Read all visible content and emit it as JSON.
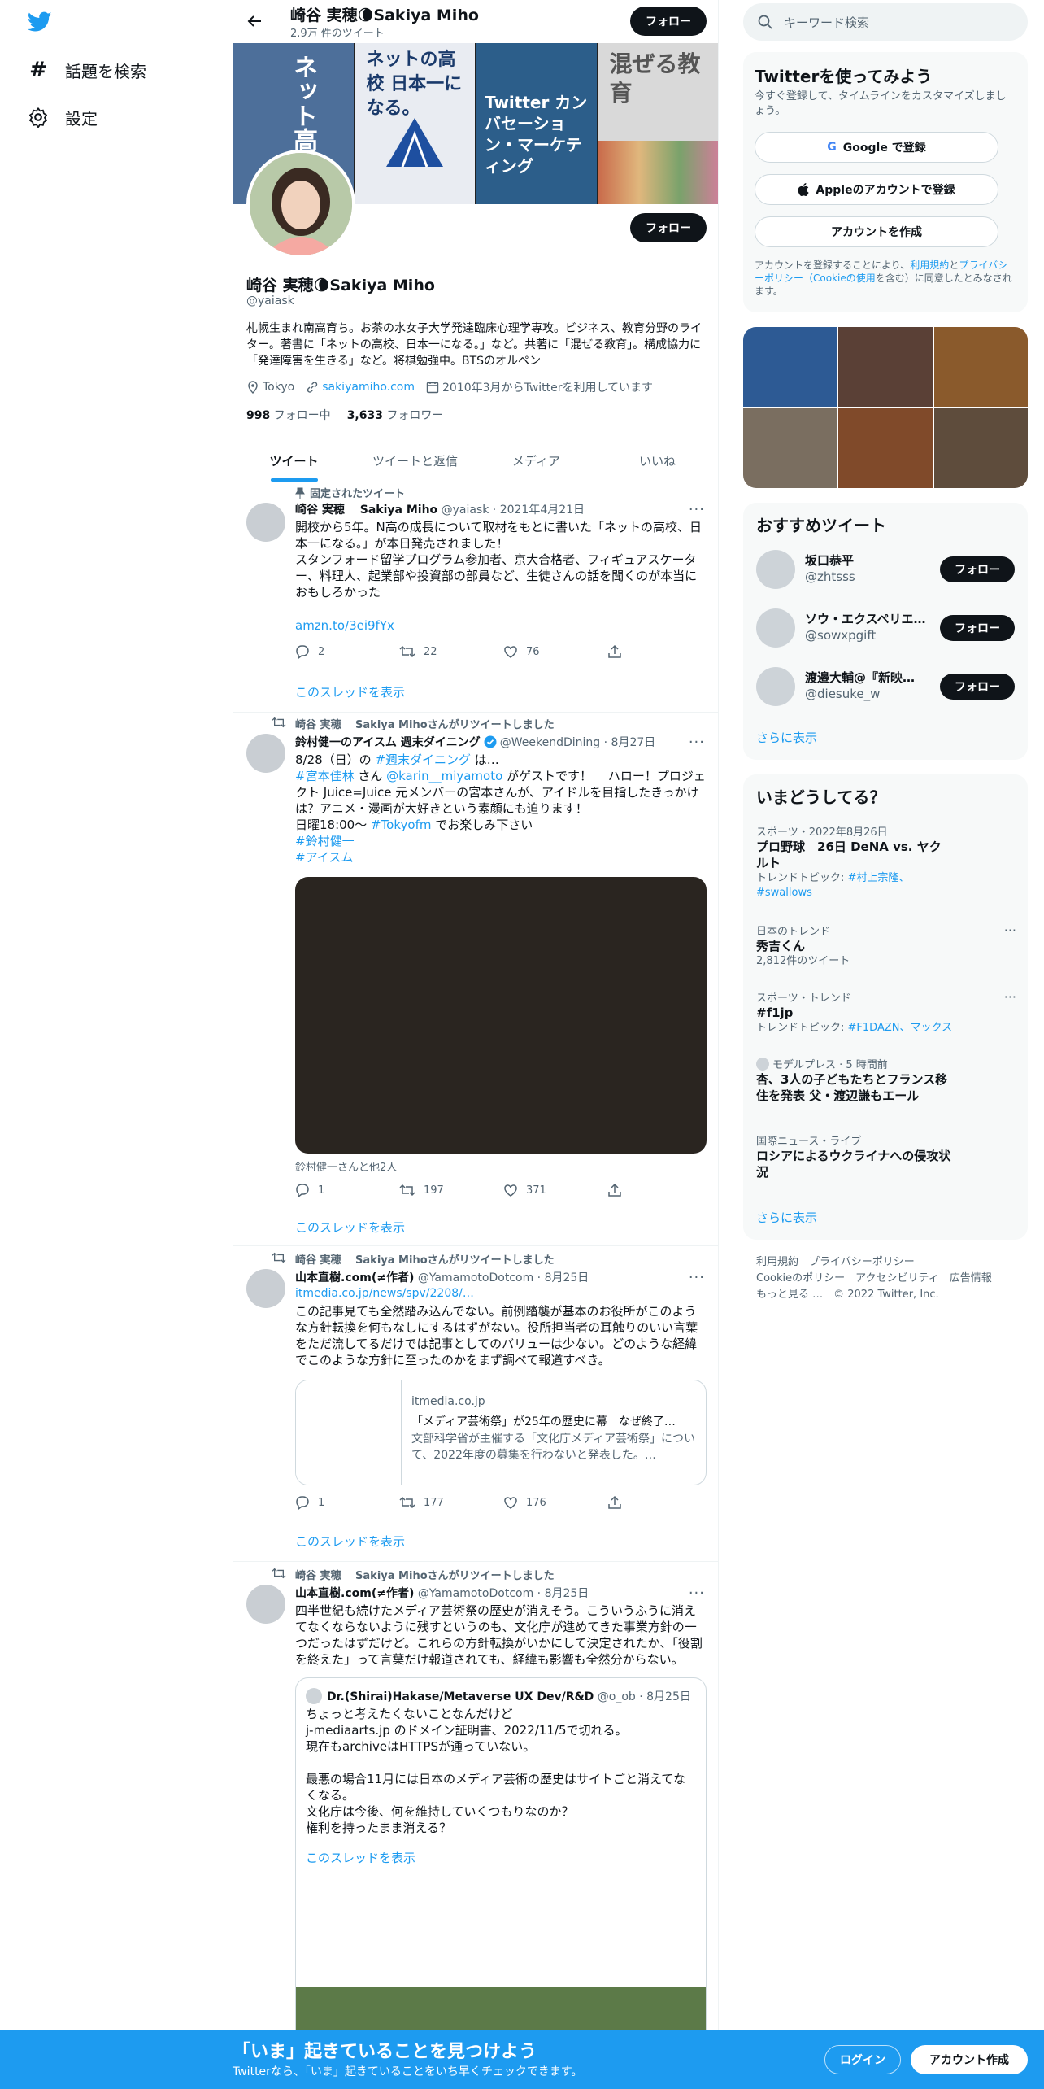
{
  "leftnav": {
    "items": [
      {
        "label": "話題を検索",
        "icon": "hashtag-icon"
      },
      {
        "label": "設定",
        "icon": "gear-icon"
      }
    ]
  },
  "profile_header": {
    "name": "崎谷 実穂🌘Sakiya Miho",
    "tweet_count": "2.9万 件のツイート",
    "follow_label": "フォロー"
  },
  "banner_books": [
    {
      "title": "ネット高校"
    },
    {
      "title": "ネットの高校 日本一になる。"
    },
    {
      "title": "Twitter カンバセーション・マーケティング"
    },
    {
      "title": "混ぜる教育"
    }
  ],
  "profile": {
    "name": "崎谷 実穂🌘Sakiya Miho",
    "handle": "@yaiask",
    "bio": "札幌生まれ南高育ち。お茶の水女子大学発達臨床心理学専攻。ビジネス、教育分野のライター。著書に「ネットの高校、日本一になる。」など。共著に「混ぜる教育」。構成協力に「発達障害を生きる」など。将棋勉強中。BTSのオルペン",
    "location": "Tokyo",
    "website": "sakiyamiho.com",
    "joined": "2010年3月からTwitterを利用しています",
    "following_count": "998",
    "following_label": "フォロー中",
    "followers_count": "3,633",
    "followers_label": "フォロワー"
  },
  "tabs": [
    {
      "label": "ツイート",
      "active": true
    },
    {
      "label": "ツイートと返信",
      "active": false
    },
    {
      "label": "メディア",
      "active": false
    },
    {
      "label": "いいね",
      "active": false
    }
  ],
  "tweets": [
    {
      "context": "固定されたツイート",
      "author": "崎谷 実穂　 Sakiya Miho",
      "handle_date": "@yaiask · 2021年4月21日",
      "text": "開校から5年。N高の成長について取材をもとに書いた「ネットの高校、日本一になる。」が本日発売されました！\nスタンフォード留学プログラム参加者、京大合格者、フィギュアスケーター、料理人、起業部や投資部の部員など、生徒さんの話を聞くのが本当におもしろかった",
      "link": "amzn.to/3ei9fYx",
      "replies": "2",
      "retweets": "22",
      "likes": "76",
      "show_thread": "このスレッドを表示"
    },
    {
      "context": "崎谷 実穂　 Sakiya Mihoさんがリツイートしました",
      "author": "鈴村健一のアイスム 週末ダイニング",
      "handle_date": "@WeekendDining · 8月27日",
      "line1_pre": "8/28（日）の ",
      "line1_tag": "#週末ダイニング",
      "line1_post": " は…",
      "line2_tag": "#宮本佳林",
      "line2_mid": " さん ",
      "line2_mention": "@karin__miyamoto",
      "line2_post": " がゲストです！　 ハロー！プロジェクト Juice=Juice 元メンバーの宮本さんが、アイドルを目指したきっかけは？アニメ・漫画が大好きという素顔にも迫ります！",
      "line3_pre": "日曜18:00〜 ",
      "line3_tag": "#Tokyofm",
      "line3_post": " でお楽しみ下さい",
      "tag4": "#鈴村健一",
      "tag5": "#アイスム",
      "media_caption": "鈴村健一さんと他2人",
      "replies": "1",
      "retweets": "197",
      "likes": "371",
      "show_thread": "このスレッドを表示"
    },
    {
      "context": "崎谷 実穂　 Sakiya Mihoさんがリツイートしました",
      "author": "山本直樹.com(≠作者)",
      "handle_date": "@YamamotoDotcom · 8月25日",
      "link": "itmedia.co.jp/news/spv/2208/…",
      "text": "この記事見ても全然踏み込んでない。前例踏襲が基本のお役所がこのような方針転換を何もなしにするはずがない。役所担当者の耳触りのいい言葉をただ流してるだけでは記事としてのバリューは少ない。どのような経緯でこのような方針に至ったのかをまず調べて報道すべき。",
      "card_domain": "itmedia.co.jp",
      "card_title": "「メディア芸術祭」が25年の歴史に幕　なぜ終了…",
      "card_desc": "文部科学省が主催する「文化庁メディア芸術祭」について、2022年度の募集を行わないと発表した。…",
      "replies": "1",
      "retweets": "177",
      "likes": "176",
      "show_thread": "このスレッドを表示"
    },
    {
      "context": "崎谷 実穂　 Sakiya Mihoさんがリツイートしました",
      "author": "山本直樹.com(≠作者)",
      "handle_date": "@YamamotoDotcom · 8月25日",
      "text": "四半世紀も続けたメディア芸術祭の歴史が消えそう。こういうふうに消えてなくならないように残すというのも、文化庁が進めてきた事業方針の一つだったはずだけど。これらの方針転換がいかにして決定されたか、「役割を終えた」って言葉だけ報道されても、経緯も影響も全然分からない。",
      "quote_author": "Dr.(Shirai)Hakase/Metaverse UX Dev/R&D",
      "quote_handle_date": "@o_ob · 8月25日",
      "quote_text": "ちょっと考えたくないことなんだけど\nj-mediaarts.jp のドメイン証明書、2022/11/5で切れる。\n現在もarchiveはHTTPSが通っていない。\n\n最悪の場合11月には日本のメディア芸術の歴史はサイトごと消えてなくなる。\n文化庁は今後、何を維持していくつもりなのか？\n権利を持ったまま消える？",
      "quote_show_thread": "このスレッドを表示"
    }
  ],
  "right": {
    "search_placeholder": "キーワード検索",
    "signup": {
      "title": "Twitterを使ってみよう",
      "subtitle": "今すぐ登録して、タイムラインをカスタマイズしましょう。",
      "google": "Google で登録",
      "apple": "Appleのアカウントで登録",
      "create": "アカウントを作成",
      "terms_pre": "アカウントを登録することにより、",
      "terms_link1": "利用規約",
      "terms_mid1": "と",
      "terms_link2": "プライバシーポリシー（Cookieの使用",
      "terms_post": "を含む）に同意したとみなされます。"
    },
    "recommended": {
      "title": "おすすめツイート",
      "users": [
        {
          "name": "坂口恭平",
          "handle": "@zhtsss"
        },
        {
          "name": "ソウ・エクスペリエンス",
          "handle": "@sowxpgift"
        },
        {
          "name": "渡邉大輔@『新映画論』",
          "handle": "@diesuke_w"
        }
      ],
      "follow_label": "フォロー",
      "more": "さらに表示"
    },
    "trends": {
      "title": "いまどうしてる？",
      "items": [
        {
          "cat": "スポーツ・2022年8月26日",
          "title": "プロ野球　26日 DeNA vs. ヤクルト",
          "sub_pre": "トレンドトピック: ",
          "sub_link": "#村上宗隆、#swallows"
        },
        {
          "cat": "日本のトレンド",
          "title": "秀吉くん",
          "sub_pre": "2,812件のツイート",
          "sub_link": ""
        },
        {
          "cat": "スポーツ・トレンド",
          "title": "#f1jp",
          "sub_pre": "トレンドトピック: ",
          "sub_link": "#F1DAZN、マックス"
        },
        {
          "cat": "モデルプレス · 5 時間前",
          "title": "杏、3人の子どもたちとフランス移住を発表 父・渡辺謙もエール",
          "sub_pre": "",
          "sub_link": ""
        },
        {
          "cat": "国際ニュース・ライブ",
          "title": "ロシアによるウクライナへの侵攻状況",
          "sub_pre": "",
          "sub_link": ""
        }
      ],
      "more": "さらに表示"
    },
    "footer": {
      "line1": "利用規約　プライバシーポリシー",
      "line2": "Cookieのポリシー　アクセシビリティ　広告情報",
      "line3": "もっと見る …　© 2022 Twitter, Inc."
    }
  },
  "bottombar": {
    "title": "「いま」起きていることを見つけよう",
    "subtitle": "Twitterなら、「いま」起きていることをいち早くチェックできます。",
    "login": "ログイン",
    "signup": "アカウント作成"
  },
  "colors": {
    "accent": "#1d9bf0",
    "text": "#0f1419",
    "muted": "#536471"
  }
}
